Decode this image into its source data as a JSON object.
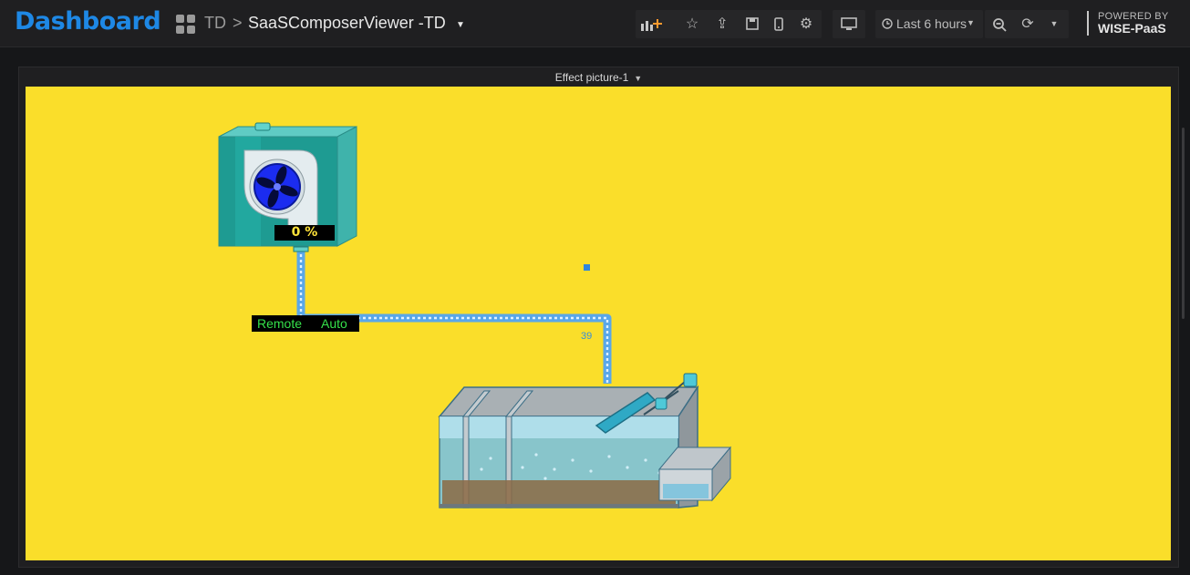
{
  "app": {
    "logo_text": "Dashboard"
  },
  "breadcrumb": {
    "root": "TD",
    "separator": ">",
    "title": "SaaSComposerViewer -TD"
  },
  "toolbar": {
    "buttons": [
      "add-panel-icon",
      "star-icon",
      "share-icon",
      "save-icon",
      "mobile-icon",
      "gear-icon",
      "monitor-icon"
    ],
    "time_range": "Last 6 hours"
  },
  "brand": {
    "line1": "POWERED BY",
    "line2": "WISE-PaaS"
  },
  "panel": {
    "title": "Effect picture-1"
  },
  "fan_unit": {
    "speed_readout": "0 %",
    "mode_1": "Remote",
    "mode_2": "Auto"
  },
  "marker": {
    "value": "39"
  },
  "colors": {
    "canvas_bg": "#fade2a",
    "accent": "#1e88e5",
    "pipe": "#5aa7e8"
  }
}
